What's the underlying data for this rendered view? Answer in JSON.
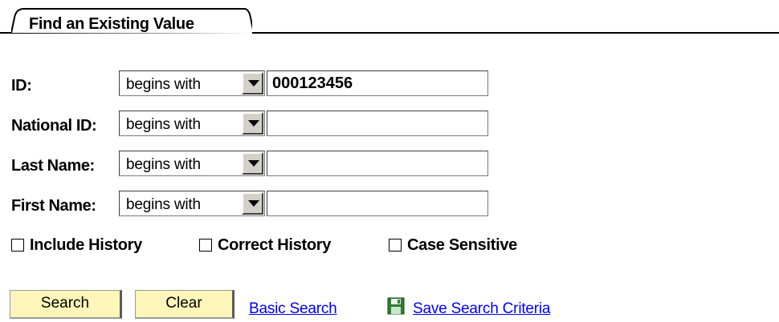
{
  "tab": {
    "label": "Find an Existing Value"
  },
  "fields": [
    {
      "label": "ID:",
      "operator": "begins with",
      "value": "000123456"
    },
    {
      "label": "National ID:",
      "operator": "begins with",
      "value": ""
    },
    {
      "label": "Last Name:",
      "operator": "begins with",
      "value": ""
    },
    {
      "label": "First Name:",
      "operator": "begins with",
      "value": ""
    }
  ],
  "options": [
    {
      "label": "Include History",
      "checked": false
    },
    {
      "label": "Correct History",
      "checked": false
    },
    {
      "label": "Case Sensitive",
      "checked": false
    }
  ],
  "actions": {
    "search_label": "Search",
    "clear_label": "Clear",
    "basic_search_label": "Basic Search",
    "save_criteria_label": "Save Search Criteria"
  },
  "icons": {
    "save": "floppy-disk-icon"
  },
  "colors": {
    "button_bg": "#fdf6b8",
    "link": "#0000ee",
    "save_icon": "#2e7d32"
  }
}
